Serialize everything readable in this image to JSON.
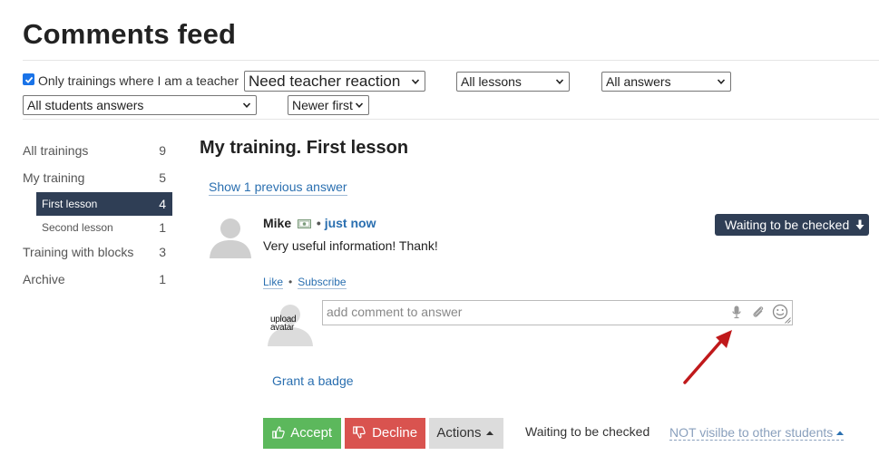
{
  "page": {
    "title": "Comments feed"
  },
  "filters": {
    "only_teacher_label": "Only trainings where I am a teacher",
    "only_teacher_checked": true,
    "reaction": "Need teacher reaction",
    "lessons": "All lessons",
    "answers": "All answers",
    "students_answers": "All students answers",
    "order": "Newer first"
  },
  "sidebar": {
    "items": [
      {
        "label": "All trainings",
        "count": "9"
      },
      {
        "label": "My training",
        "count": "5"
      },
      {
        "label": "First lesson",
        "count": "4"
      },
      {
        "label": "Second lesson",
        "count": "1"
      },
      {
        "label": "Training with blocks",
        "count": "3"
      },
      {
        "label": "Archive",
        "count": "1"
      }
    ]
  },
  "feed": {
    "lesson_title": "My training. First lesson",
    "show_previous": "Show 1 previous answer",
    "answer": {
      "author": "Mike",
      "separator": "•",
      "time": "just now",
      "text": "Very useful information! Thank!",
      "status_button": "Waiting to be checked"
    },
    "links": {
      "like": "Like",
      "separator": "•",
      "subscribe": "Subscribe"
    },
    "upload_avatar": "upload avatar",
    "comment_placeholder": "add comment to answer",
    "grant_badge": "Grant a badge",
    "actions": {
      "accept": "Accept",
      "decline": "Decline",
      "actions": "Actions",
      "waiting_text": "Waiting to be checked",
      "visibility": "NOT visilbe to other students"
    }
  },
  "colors": {
    "accent": "#2a6fb0",
    "dark_navy": "#2f3e55",
    "accept_green": "#5cb85c",
    "decline_red": "#d9534f",
    "annotation_arrow": "#c0191b"
  }
}
